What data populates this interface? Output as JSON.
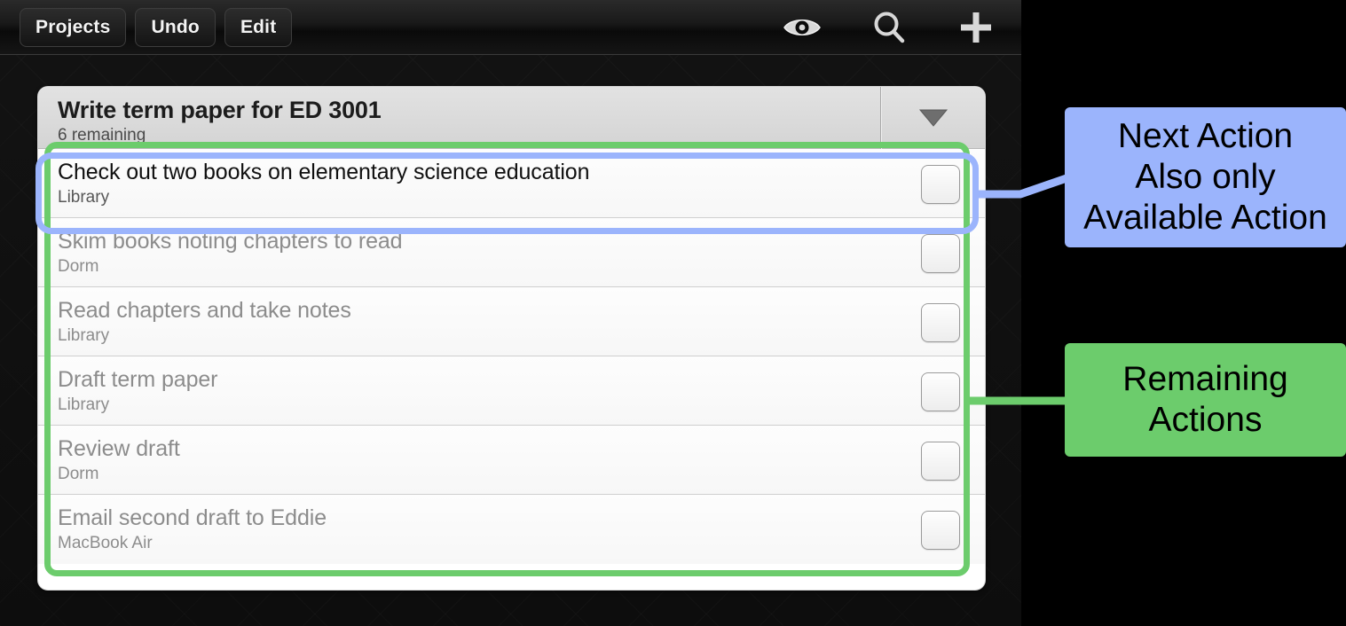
{
  "app": {
    "toolbar": {
      "buttons": [
        {
          "label": "Projects",
          "name": "projects-button"
        },
        {
          "label": "Undo",
          "name": "undo-button"
        },
        {
          "label": "Edit",
          "name": "edit-button"
        }
      ],
      "icons": [
        {
          "name": "eye-icon",
          "label": "View"
        },
        {
          "name": "search-icon",
          "label": "Search"
        },
        {
          "name": "plus-icon",
          "label": "Add"
        }
      ]
    },
    "project": {
      "title": "Write term paper for ED 3001",
      "subtitle": "6 remaining",
      "disclosure_icon": "chevron-down-icon"
    },
    "tasks": [
      {
        "title": "Check out two books on elementary science education",
        "context": "Library",
        "state": "available"
      },
      {
        "title": "Skim books noting chapters to read",
        "context": "Dorm",
        "state": "blocked"
      },
      {
        "title": "Read chapters and take notes",
        "context": "Library",
        "state": "blocked"
      },
      {
        "title": "Draft term paper",
        "context": "Library",
        "state": "blocked"
      },
      {
        "title": "Review draft",
        "context": "Dorm",
        "state": "blocked"
      },
      {
        "title": "Email second draft to Eddie",
        "context": "MacBook Air",
        "state": "blocked"
      }
    ]
  },
  "annotations": {
    "next_action": {
      "lines": [
        "Next Action",
        "Also only",
        "Available Action"
      ],
      "color": "#9BB4FC"
    },
    "remaining": {
      "lines": [
        "Remaining",
        "Actions"
      ],
      "color": "#6CCC6C"
    }
  },
  "colors": {
    "accent_blue": "#9BB4FC",
    "accent_green": "#6CCC6C",
    "background": "#000000",
    "app_background": "#111111"
  }
}
